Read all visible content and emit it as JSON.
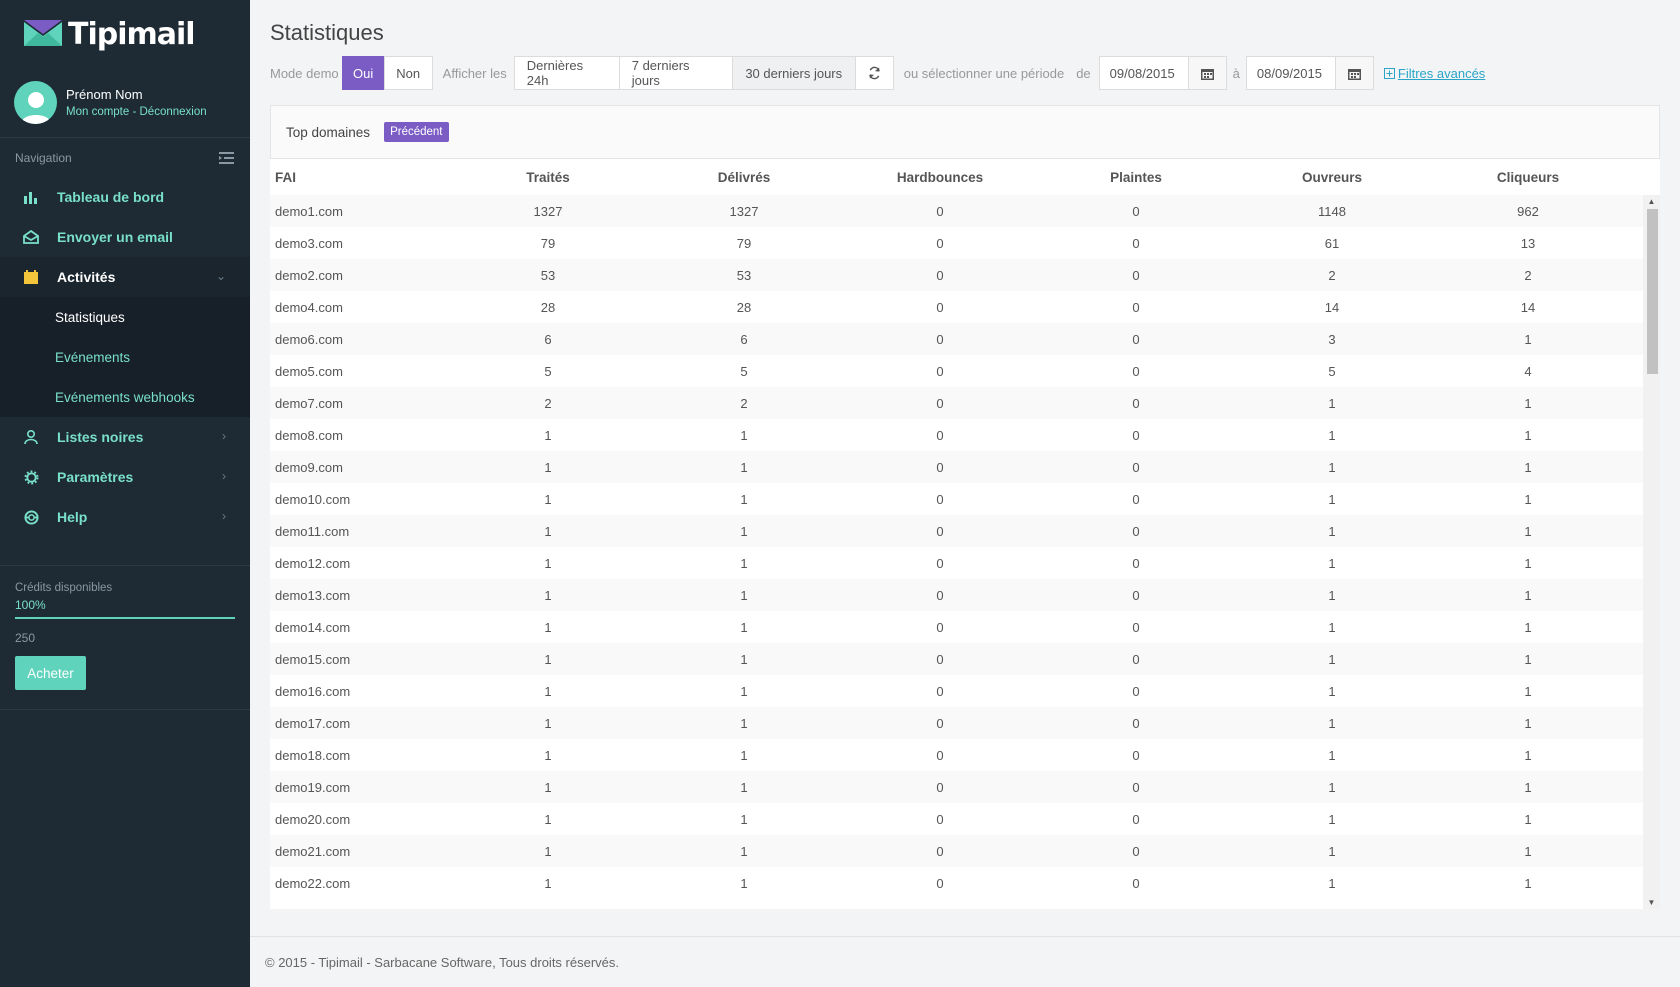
{
  "app": {
    "logo_text": "Tipimail"
  },
  "user": {
    "name": "Prénom Nom",
    "links": "Mon compte - Déconnexion"
  },
  "nav": {
    "header": "Navigation",
    "items": [
      {
        "label": "Tableau de bord",
        "icon": "bar-chart-icon"
      },
      {
        "label": "Envoyer un email",
        "icon": "envelope-open-icon"
      },
      {
        "label": "Activités",
        "icon": "calendar-icon"
      },
      {
        "label": "Listes noires",
        "icon": "user-icon"
      },
      {
        "label": "Paramètres",
        "icon": "gear-icon"
      },
      {
        "label": "Help",
        "icon": "lifebuoy-icon"
      }
    ],
    "sub": [
      "Statistiques",
      "Evénements",
      "Evénements webhooks"
    ]
  },
  "credits": {
    "label": "Crédits disponibles",
    "percent": "100%",
    "level": 1.0,
    "count": "250",
    "buy": "Acheter"
  },
  "page": {
    "title": "Statistiques"
  },
  "toolbar": {
    "mode_label": "Mode demo",
    "oui": "Oui",
    "non": "Non",
    "afficher": "Afficher les",
    "p24": "Dernières 24h",
    "p7": "7 derniers jours",
    "p30": "30 derniers jours",
    "or_select": "ou sélectionner une période",
    "de": "de",
    "date_from": "09/08/2015",
    "a": "à",
    "date_to": "08/09/2015",
    "advanced": "Filtres avancés"
  },
  "panel": {
    "title": "Top domaines",
    "prev": "Précédent"
  },
  "table": {
    "headers": [
      "FAI",
      "Traités",
      "Délivrés",
      "Hardbounces",
      "Plaintes",
      "Ouvreurs",
      "Cliqueurs"
    ],
    "rows": [
      [
        "demo1.com",
        "1327",
        "1327",
        "0",
        "0",
        "1148",
        "962"
      ],
      [
        "demo3.com",
        "79",
        "79",
        "0",
        "0",
        "61",
        "13"
      ],
      [
        "demo2.com",
        "53",
        "53",
        "0",
        "0",
        "2",
        "2"
      ],
      [
        "demo4.com",
        "28",
        "28",
        "0",
        "0",
        "14",
        "14"
      ],
      [
        "demo6.com",
        "6",
        "6",
        "0",
        "0",
        "3",
        "1"
      ],
      [
        "demo5.com",
        "5",
        "5",
        "0",
        "0",
        "5",
        "4"
      ],
      [
        "demo7.com",
        "2",
        "2",
        "0",
        "0",
        "1",
        "1"
      ],
      [
        "demo8.com",
        "1",
        "1",
        "0",
        "0",
        "1",
        "1"
      ],
      [
        "demo9.com",
        "1",
        "1",
        "0",
        "0",
        "1",
        "1"
      ],
      [
        "demo10.com",
        "1",
        "1",
        "0",
        "0",
        "1",
        "1"
      ],
      [
        "demo11.com",
        "1",
        "1",
        "0",
        "0",
        "1",
        "1"
      ],
      [
        "demo12.com",
        "1",
        "1",
        "0",
        "0",
        "1",
        "1"
      ],
      [
        "demo13.com",
        "1",
        "1",
        "0",
        "0",
        "1",
        "1"
      ],
      [
        "demo14.com",
        "1",
        "1",
        "0",
        "0",
        "1",
        "1"
      ],
      [
        "demo15.com",
        "1",
        "1",
        "0",
        "0",
        "1",
        "1"
      ],
      [
        "demo16.com",
        "1",
        "1",
        "0",
        "0",
        "1",
        "1"
      ],
      [
        "demo17.com",
        "1",
        "1",
        "0",
        "0",
        "1",
        "1"
      ],
      [
        "demo18.com",
        "1",
        "1",
        "0",
        "0",
        "1",
        "1"
      ],
      [
        "demo19.com",
        "1",
        "1",
        "0",
        "0",
        "1",
        "1"
      ],
      [
        "demo20.com",
        "1",
        "1",
        "0",
        "0",
        "1",
        "1"
      ],
      [
        "demo21.com",
        "1",
        "1",
        "0",
        "0",
        "1",
        "1"
      ],
      [
        "demo22.com",
        "1",
        "1",
        "0",
        "0",
        "1",
        "1"
      ]
    ]
  },
  "footer": {
    "text": "© 2015 - Tipimail - Sarbacane Software, Tous droits réservés."
  },
  "colors": {
    "sidebar": "#1e2b35",
    "accent": "#5fd3bc",
    "purple": "#7a5cc4",
    "link": "#2aa5c7"
  }
}
